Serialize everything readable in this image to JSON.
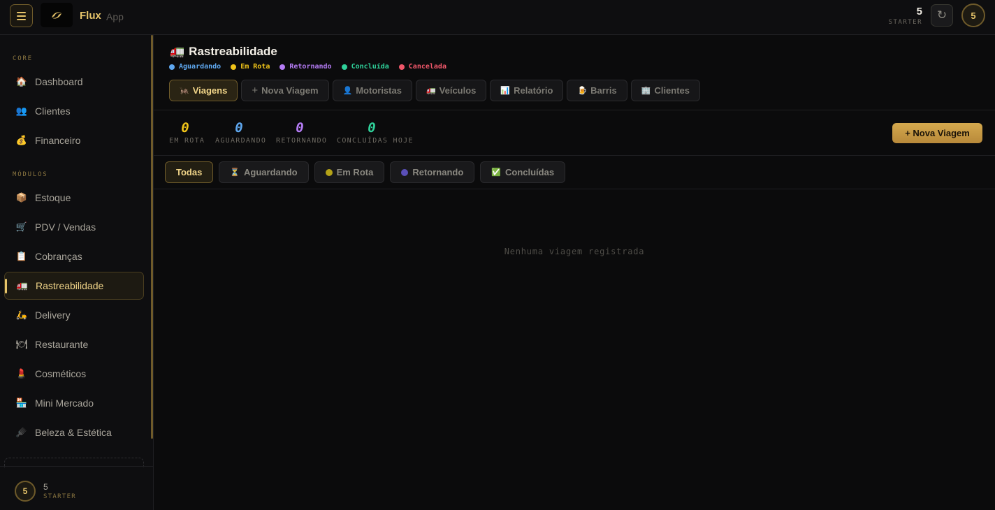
{
  "app": {
    "brand": "Flux",
    "brand_sub": "App"
  },
  "topbar": {
    "user_number": "5",
    "user_plan": "STARTER",
    "avatar_initial": "5",
    "refresh_glyph": "↻"
  },
  "sidebar": {
    "sections": [
      {
        "label": "CORE"
      },
      {
        "label": "MÓDULOS"
      }
    ],
    "items": [
      {
        "label": "Dashboard",
        "icon": "🏠"
      },
      {
        "label": "Clientes",
        "icon": "👥"
      },
      {
        "label": "Financeiro",
        "icon": "💰"
      },
      {
        "label": "Estoque",
        "icon": "📦"
      },
      {
        "label": "PDV / Vendas",
        "icon": "🛒"
      },
      {
        "label": "Cobranças",
        "icon": "📋"
      },
      {
        "label": "Rastreabilidade",
        "icon": "🚛"
      },
      {
        "label": "Delivery",
        "icon": "🛵"
      },
      {
        "label": "Restaurante",
        "icon": "🍽"
      },
      {
        "label": "Cosméticos",
        "icon": "💄"
      },
      {
        "label": "Mini Mercado",
        "icon": "🏪"
      },
      {
        "label": "Beleza & Estética",
        "icon": "🪮"
      }
    ],
    "footer": {
      "avatar_initial": "5",
      "user_number": "5",
      "user_plan": "STARTER"
    }
  },
  "page": {
    "title": "Rastreabilidade",
    "title_icon": "🚛",
    "legend": [
      {
        "label": "Aguardando",
        "color": "#5fa8f0"
      },
      {
        "label": "Em Rota",
        "color": "#f0c419"
      },
      {
        "label": "Retornando",
        "color": "#b57cf5"
      },
      {
        "label": "Concluída",
        "color": "#2fd19a"
      },
      {
        "label": "Cancelada",
        "color": "#f0576a"
      }
    ],
    "tabs": [
      {
        "label": "Viagens",
        "icon": "🦗"
      },
      {
        "label": "Nova Viagem",
        "icon": "+"
      },
      {
        "label": "Motoristas",
        "icon": "👤"
      },
      {
        "label": "Veículos",
        "icon": "🚛"
      },
      {
        "label": "Relatório",
        "icon": "📊"
      },
      {
        "label": "Barris",
        "icon": "🍺"
      },
      {
        "label": "Clientes",
        "icon": "🏢"
      }
    ],
    "stats": [
      {
        "value": "0",
        "label": "EM ROTA",
        "color": "#f0c419"
      },
      {
        "value": "0",
        "label": "AGUARDANDO",
        "color": "#5fa8f0"
      },
      {
        "value": "0",
        "label": "RETORNANDO",
        "color": "#b57cf5"
      },
      {
        "value": "0",
        "label": "CONCLUÍDAS HOJE",
        "color": "#2fd19a"
      }
    ],
    "new_trip_button": "+ Nova Viagem",
    "filters": [
      {
        "label": "Todas",
        "icon": ""
      },
      {
        "label": "Aguardando",
        "icon": "⏳"
      },
      {
        "label": "Em Rota",
        "icon": "",
        "dot": "#b5a318"
      },
      {
        "label": "Retornando",
        "icon": "",
        "dot": "#5a4fb8"
      },
      {
        "label": "Concluídas",
        "icon": "✅"
      }
    ],
    "empty_message": "Nenhuma viagem registrada"
  }
}
